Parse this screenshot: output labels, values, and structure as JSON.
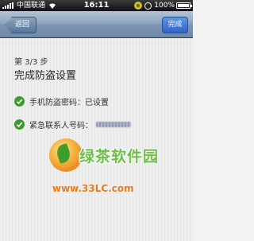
{
  "status_bar": {
    "carrier": "中国联通",
    "time": "16:11",
    "battery": "100%"
  },
  "nav": {
    "back_label": "返回",
    "done_label": "完成"
  },
  "page": {
    "step": "第 3/3 步",
    "title": "完成防盗设置"
  },
  "items": [
    {
      "label": "手机防盗密码：已设置"
    },
    {
      "label": "紧急联系人号码："
    }
  ],
  "watermark": {
    "brand": "绿茶软件园",
    "url": "www.33LC.com"
  }
}
